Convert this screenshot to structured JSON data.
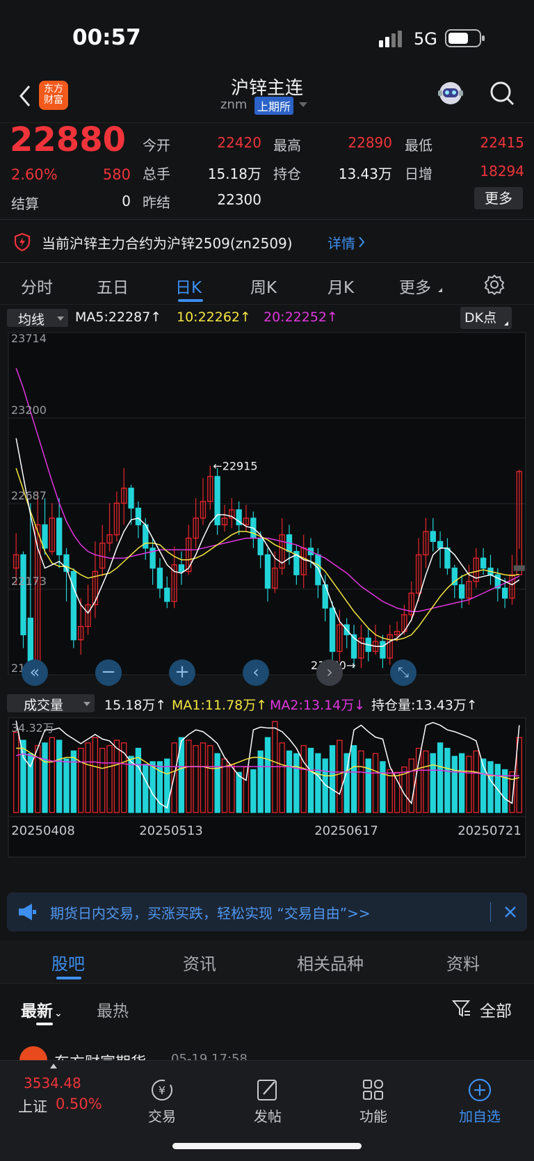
{
  "status": {
    "time": "00:57",
    "network": "5G"
  },
  "header": {
    "logo_text_1": "东方",
    "logo_text_2": "财富",
    "title": "沪锌主连",
    "code": "znm",
    "exchange": "上期所"
  },
  "quote": {
    "price": "22880",
    "change_pct": "2.60%",
    "change": "580",
    "settle_label": "结算",
    "settle": "0",
    "rows": [
      {
        "l1": "今开",
        "v1": "22420",
        "l2": "最高",
        "v2": "22890",
        "l3": "最低",
        "v3": "22415"
      },
      {
        "l1": "总手",
        "v1": "15.18万",
        "l2": "持仓",
        "v2": "13.43万",
        "l3": "日增",
        "v3": "18294"
      },
      {
        "l1": "昨结",
        "v1": "22300"
      }
    ],
    "more": "更多"
  },
  "notice": {
    "text": "当前沪锌主力合约为沪锌2509(zn2509)",
    "link": "详情"
  },
  "tabs": [
    "分时",
    "五日",
    "日K",
    "周K",
    "月K",
    "更多"
  ],
  "indicator": {
    "select": "均线",
    "ma5": "MA5:22287",
    "ma10": "10:22262",
    "ma20": "20:22252",
    "dk": "DK点"
  },
  "volume_bar": {
    "select": "成交量",
    "vol": "15.18万",
    "ma1": "MA1:11.78万",
    "ma2": "MA2:13.14万",
    "oi": "持仓量:13.43万"
  },
  "chart_data": {
    "type": "candlestick",
    "price_axis": [
      "23714",
      "23200",
      "22687",
      "22173",
      "21660"
    ],
    "high_mark": "←22915",
    "low_mark": "21660→",
    "volume_max": "34.32万",
    "dates": [
      "20250408",
      "20250513",
      "20250617",
      "20250721"
    ],
    "colors": {
      "up": "#e8262b",
      "down": "#22d3d8",
      "ma5": "#ffffff",
      "ma10": "#f5e640",
      "ma20": "#e136e0"
    },
    "ylim": [
      21660,
      23714
    ],
    "candles": [
      [
        22300,
        22380,
        22510,
        22200
      ],
      [
        22380,
        21900,
        22400,
        21820
      ],
      [
        22000,
        21700,
        22690,
        21660
      ],
      [
        21720,
        22560,
        22760,
        21700
      ],
      [
        22560,
        22420,
        22720,
        22380
      ],
      [
        22400,
        22600,
        22690,
        22380
      ],
      [
        22600,
        22380,
        22720,
        22300
      ],
      [
        22380,
        22280,
        22420,
        22100
      ],
      [
        22280,
        21870,
        22300,
        21820
      ],
      [
        21870,
        21950,
        22120,
        21780
      ],
      [
        21950,
        22080,
        22200,
        21900
      ],
      [
        22080,
        22280,
        22460,
        22000
      ],
      [
        22300,
        22450,
        22560,
        22250
      ],
      [
        22450,
        22500,
        22690,
        22400
      ],
      [
        22500,
        22690,
        22760,
        22460
      ],
      [
        22690,
        22780,
        22900,
        22560
      ],
      [
        22780,
        22660,
        22800,
        22560
      ],
      [
        22660,
        22560,
        22700,
        22480
      ],
      [
        22560,
        22420,
        22600,
        22350
      ],
      [
        22420,
        22300,
        22480,
        22200
      ],
      [
        22300,
        22180,
        22360,
        22120
      ],
      [
        22180,
        22100,
        22250,
        22060
      ],
      [
        22100,
        22320,
        22430,
        22060
      ],
      [
        22320,
        22280,
        22400,
        22200
      ],
      [
        22280,
        22480,
        22560,
        22260
      ],
      [
        22480,
        22600,
        22720,
        22420
      ],
      [
        22600,
        22700,
        22840,
        22560
      ],
      [
        22700,
        22850,
        22915,
        22650
      ],
      [
        22850,
        22560,
        22900,
        22500
      ],
      [
        22560,
        22600,
        22680,
        22520
      ],
      [
        22600,
        22650,
        22720,
        22540
      ],
      [
        22650,
        22560,
        22700,
        22500
      ],
      [
        22560,
        22600,
        22680,
        22520
      ],
      [
        22600,
        22480,
        22640,
        22420
      ],
      [
        22480,
        22380,
        22520,
        22300
      ],
      [
        22380,
        22180,
        22420,
        22100
      ],
      [
        22180,
        22300,
        22400,
        22150
      ],
      [
        22300,
        22500,
        22600,
        22260
      ],
      [
        22500,
        22400,
        22560,
        22320
      ],
      [
        22400,
        22260,
        22440,
        22200
      ],
      [
        22260,
        22420,
        22500,
        22180
      ],
      [
        22420,
        22380,
        22480,
        22300
      ],
      [
        22380,
        22200,
        22420,
        22120
      ],
      [
        22200,
        22060,
        22260,
        21980
      ],
      [
        22060,
        21800,
        22100,
        21700
      ],
      [
        21800,
        21960,
        22050,
        21740
      ],
      [
        21960,
        21900,
        22000,
        21820
      ],
      [
        21900,
        21760,
        21960,
        21700
      ],
      [
        21760,
        21880,
        21960,
        21700
      ],
      [
        21880,
        21800,
        21940,
        21740
      ],
      [
        21800,
        21860,
        21960,
        21780
      ],
      [
        21860,
        21760,
        21900,
        21700
      ],
      [
        21760,
        21900,
        21960,
        21720
      ],
      [
        21900,
        21920,
        21980,
        21860
      ],
      [
        21920,
        22020,
        22080,
        21900
      ],
      [
        22020,
        22150,
        22220,
        21980
      ],
      [
        22150,
        22380,
        22480,
        22100
      ],
      [
        22380,
        22520,
        22600,
        22300
      ],
      [
        22520,
        22460,
        22600,
        22400
      ],
      [
        22460,
        22420,
        22520,
        22300
      ],
      [
        22420,
        22300,
        22480,
        22260
      ],
      [
        22300,
        22200,
        22320,
        22120
      ],
      [
        22200,
        22120,
        22260,
        22060
      ],
      [
        22120,
        22220,
        22320,
        22080
      ],
      [
        22220,
        22360,
        22420,
        22180
      ],
      [
        22360,
        22300,
        22420,
        22260
      ],
      [
        22300,
        22260,
        22380,
        22200
      ],
      [
        22260,
        22180,
        22300,
        22100
      ],
      [
        22180,
        22120,
        22240,
        22060
      ],
      [
        22120,
        22260,
        22380,
        22080
      ],
      [
        22260,
        22880,
        22890,
        22415
      ]
    ],
    "ma5": [
      23080,
      22850,
      22620,
      22420,
      22300,
      22320,
      22340,
      22300,
      22180,
      22080,
      22030,
      22100,
      22200,
      22300,
      22420,
      22520,
      22590,
      22600,
      22560,
      22480,
      22400,
      22320,
      22280,
      22270,
      22300,
      22380,
      22480,
      22570,
      22620,
      22620,
      22610,
      22580,
      22550,
      22540,
      22500,
      22430,
      22360,
      22330,
      22360,
      22380,
      22350,
      22340,
      22300,
      22200,
      22080,
      21980,
      21930,
      21880,
      21850,
      21840,
      21830,
      21830,
      21860,
      21880,
      21920,
      21990,
      22120,
      22260,
      22380,
      22420,
      22420,
      22380,
      22320,
      22260,
      22240,
      22250,
      22260,
      22240,
      22220,
      22200,
      22230
    ],
    "ma10": [
      22900,
      22770,
      22640,
      22520,
      22400,
      22330,
      22310,
      22310,
      22290,
      22260,
      22240,
      22250,
      22260,
      22270,
      22300,
      22340,
      22380,
      22420,
      22450,
      22450,
      22440,
      22400,
      22370,
      22350,
      22350,
      22360,
      22380,
      22410,
      22440,
      22470,
      22500,
      22520,
      22520,
      22510,
      22490,
      22470,
      22440,
      22420,
      22400,
      22380,
      22360,
      22340,
      22320,
      22280,
      22220,
      22160,
      22100,
      22040,
      21990,
      21940,
      21900,
      21880,
      21870,
      21870,
      21880,
      21900,
      21950,
      22010,
      22070,
      22130,
      22180,
      22220,
      22250,
      22270,
      22280,
      22290,
      22280,
      22270,
      22260,
      22255,
      22262
    ],
    "ma20": [
      23500,
      23380,
      23240,
      23100,
      22960,
      22820,
      22690,
      22580,
      22500,
      22440,
      22400,
      22380,
      22370,
      22360,
      22360,
      22360,
      22370,
      22380,
      22390,
      22400,
      22410,
      22410,
      22410,
      22410,
      22410,
      22410,
      22420,
      22430,
      22440,
      22450,
      22460,
      22470,
      22480,
      22480,
      22480,
      22480,
      22470,
      22460,
      22450,
      22440,
      22420,
      22400,
      22380,
      22360,
      22330,
      22300,
      22270,
      22230,
      22190,
      22160,
      22130,
      22100,
      22080,
      22060,
      22050,
      22040,
      22040,
      22050,
      22060,
      22070,
      22080,
      22090,
      22100,
      22110,
      22130,
      22150,
      22170,
      22190,
      22210,
      22230,
      22252
    ],
    "volume": [
      30,
      27,
      22,
      25,
      26,
      28,
      27,
      20,
      23,
      24,
      26,
      28,
      24,
      25,
      27,
      26,
      21,
      24,
      18,
      19,
      19,
      20,
      26,
      28,
      27,
      25,
      26,
      25,
      22,
      20,
      18,
      15,
      17,
      16,
      23,
      28,
      34,
      26,
      23,
      22,
      25,
      24,
      22,
      20,
      25,
      27,
      22,
      25,
      23,
      20,
      22,
      19,
      16,
      15,
      17,
      20,
      24,
      23,
      22,
      26,
      24,
      21,
      22,
      21,
      23,
      20,
      19,
      18,
      16,
      15.2,
      28
    ],
    "vol_ma1": [
      1,
      0.6,
      0.5,
      0.7,
      0.9,
      0.9,
      0.92,
      0.85,
      0.8,
      0.75,
      0.8,
      0.85,
      0.8,
      0.78,
      0.7,
      0.65,
      0.55,
      0.5,
      0.35,
      0.2,
      0.1,
      0.05,
      0.4,
      0.78,
      0.85,
      0.9,
      0.88,
      0.82,
      0.75,
      0.6,
      0.5,
      0.4,
      0.35,
      0.9,
      0.93,
      0.92,
      0.92,
      0.88,
      0.8,
      0.7,
      0.55,
      0.45,
      0.4,
      0.3,
      0.25,
      0.2,
      0.45,
      0.9,
      0.95,
      0.88,
      0.82,
      0.8,
      0.5,
      0.35,
      0.2,
      0.1,
      0.55,
      0.95,
      0.98,
      0.95,
      0.9,
      0.88,
      0.85,
      0.82,
      0.78,
      0.5,
      0.35,
      0.25,
      0.15,
      0.1,
      0.95
    ],
    "vol_ma2": [
      0.7,
      0.7,
      0.65,
      0.6,
      0.55,
      0.55,
      0.58,
      0.6,
      0.6,
      0.55,
      0.52,
      0.5,
      0.48,
      0.5,
      0.52,
      0.55,
      0.58,
      0.6,
      0.55,
      0.5,
      0.45,
      0.42,
      0.45,
      0.48,
      0.5,
      0.5,
      0.5,
      0.48,
      0.48,
      0.5,
      0.52,
      0.55,
      0.58,
      0.6,
      0.6,
      0.58,
      0.55,
      0.52,
      0.5,
      0.5,
      0.48,
      0.45,
      0.42,
      0.4,
      0.4,
      0.42,
      0.45,
      0.5,
      0.5,
      0.48,
      0.45,
      0.42,
      0.4,
      0.4,
      0.42,
      0.45,
      0.48,
      0.5,
      0.52,
      0.5,
      0.48,
      0.46,
      0.45,
      0.45,
      0.44,
      0.42,
      0.4,
      0.4,
      0.38,
      0.36,
      0.38
    ],
    "vol_ma3": [
      0.62,
      0.64,
      0.62,
      0.6,
      0.58,
      0.56,
      0.56,
      0.55,
      0.55,
      0.55,
      0.55,
      0.55,
      0.54,
      0.54,
      0.54,
      0.53,
      0.52,
      0.52,
      0.52,
      0.51,
      0.5,
      0.5,
      0.5,
      0.5,
      0.5,
      0.5,
      0.5,
      0.5,
      0.5,
      0.5,
      0.5,
      0.5,
      0.5,
      0.5,
      0.5,
      0.5,
      0.5,
      0.5,
      0.5,
      0.48,
      0.47,
      0.46,
      0.46,
      0.45,
      0.44,
      0.44,
      0.44,
      0.44,
      0.44,
      0.43,
      0.43,
      0.43,
      0.43,
      0.43,
      0.44,
      0.45,
      0.46,
      0.46,
      0.46,
      0.46,
      0.45,
      0.44,
      0.44,
      0.43,
      0.43,
      0.42,
      0.41,
      0.4,
      0.4,
      0.4,
      0.4
    ]
  },
  "banner": {
    "text": "期货日内交易，买涨买跌，轻松实现 “交易自由”>>"
  },
  "guba_tabs": [
    "股吧",
    "资讯",
    "相关品种",
    "资料"
  ],
  "filter": {
    "latest": "最新",
    "hot": "最热",
    "all": "全部"
  },
  "feed": {
    "author": "东方财富期货",
    "time": "05-19 17:58"
  },
  "bottom": {
    "index_value": "3534.48",
    "index_name": "上证",
    "index_pct": "0.50%",
    "items": [
      "交易",
      "发帖",
      "功能",
      "加自选"
    ]
  }
}
